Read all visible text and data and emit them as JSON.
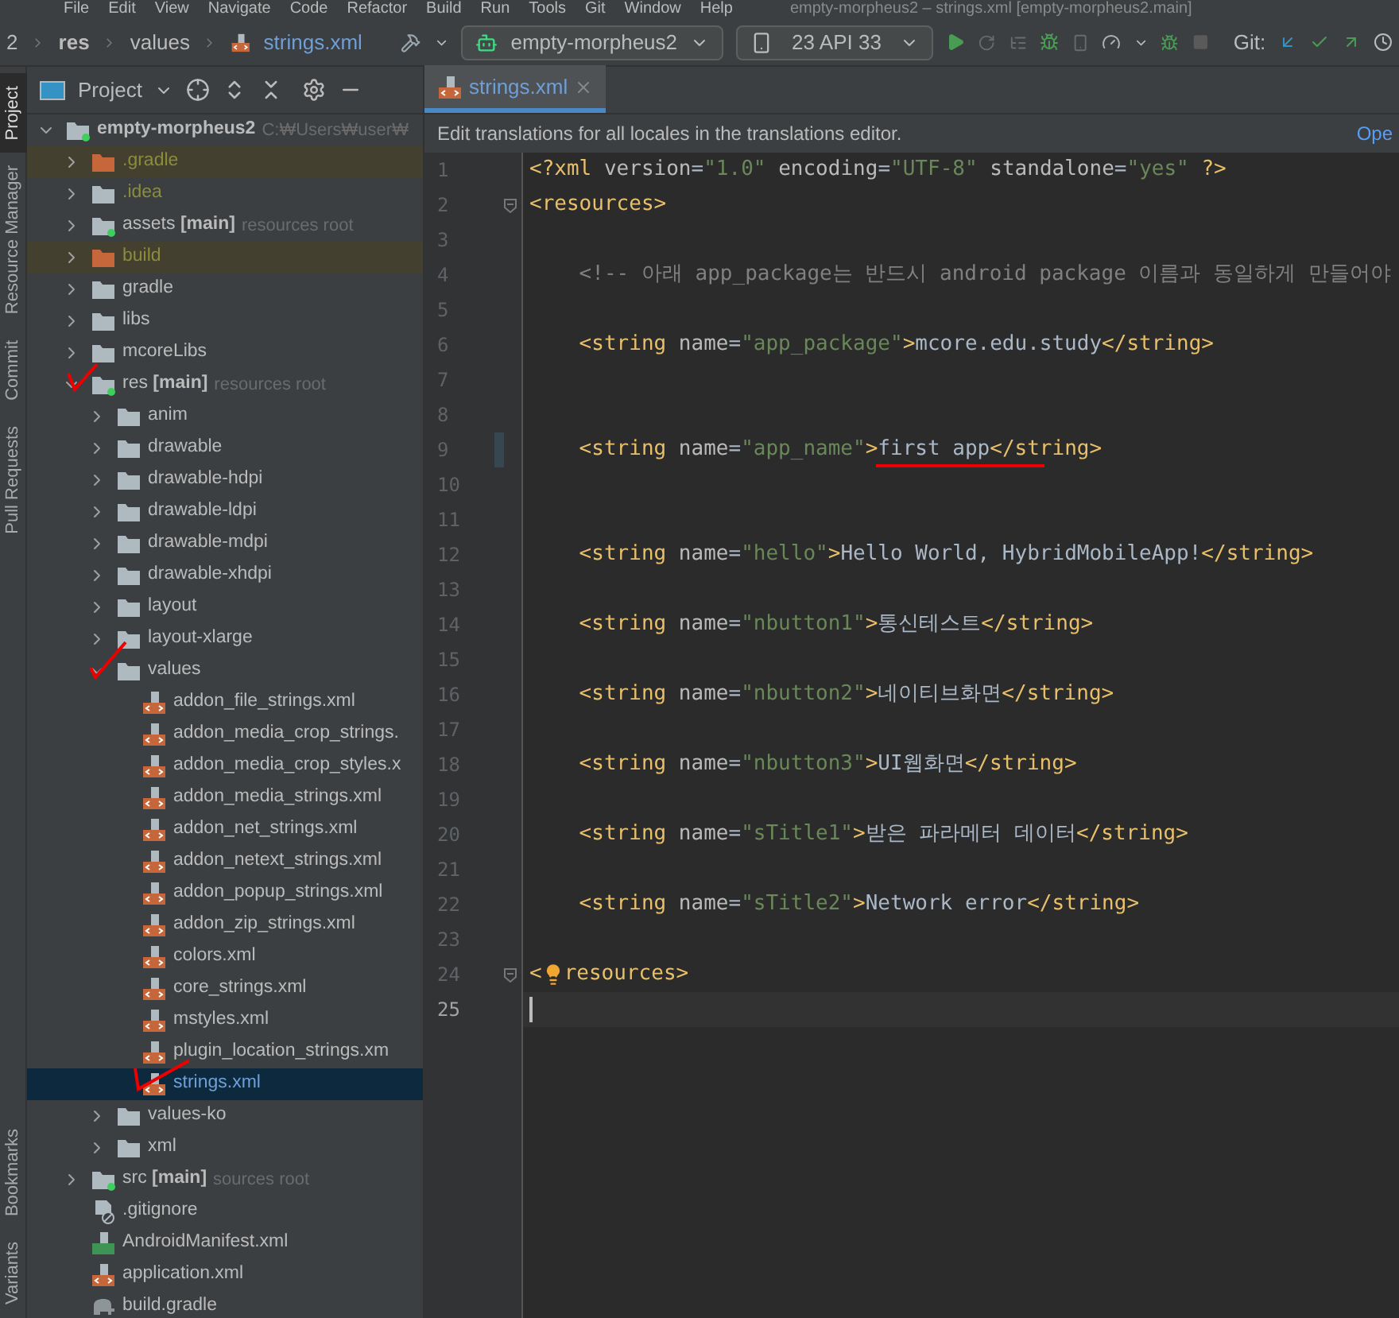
{
  "menu": {
    "items": [
      "File",
      "Edit",
      "View",
      "Navigate",
      "Code",
      "Refactor",
      "Build",
      "Run",
      "Tools",
      "Git",
      "Window",
      "Help"
    ],
    "title": "empty-morpheus2 – strings.xml [empty-morpheus2.main]"
  },
  "navbar": {
    "breadcrumbs": [
      "2",
      "res",
      "values",
      "strings.xml"
    ],
    "run_config": "empty-morpheus2",
    "device": "23",
    "api": "API 33",
    "git_label": "Git:"
  },
  "tool_strip": [
    {
      "label": "Project",
      "selected": true
    },
    {
      "label": "Resource Manager",
      "selected": false
    },
    {
      "label": "Commit",
      "selected": false
    },
    {
      "label": "Pull Requests",
      "selected": false
    },
    {
      "label": "Bookmarks",
      "selected": false
    },
    {
      "label": "Variants",
      "selected": false
    }
  ],
  "project_panel": {
    "title": "Project",
    "tree": [
      {
        "name": "empty-morpheus2",
        "kind": "module",
        "hint": "C:₩Users₩user₩",
        "selected": false,
        "expanded": true,
        "ignored": false,
        "children": [
          {
            "name": ".gradle",
            "kind": "excluded-folder",
            "selected": false,
            "expanded": false,
            "ignored": true
          },
          {
            "name": ".idea",
            "kind": "folder",
            "selected": false,
            "expanded": false,
            "ignored": true
          },
          {
            "name": "assets **[main]**",
            "kind": "source-folder",
            "hint": "resources root",
            "selected": false,
            "expanded": false,
            "ignored": false
          },
          {
            "name": "build",
            "kind": "excluded-folder",
            "selected": false,
            "expanded": false,
            "ignored": true
          },
          {
            "name": "gradle",
            "kind": "folder",
            "selected": false,
            "expanded": false,
            "ignored": false
          },
          {
            "name": "libs",
            "kind": "folder",
            "selected": false,
            "expanded": false,
            "ignored": false
          },
          {
            "name": "mcoreLibs",
            "kind": "folder",
            "selected": false,
            "expanded": false,
            "ignored": false
          },
          {
            "name": "res **[main]**",
            "kind": "source-folder",
            "hint": "resources root",
            "selected": false,
            "expanded": true,
            "ignored": false,
            "children": [
              {
                "name": "anim",
                "kind": "folder",
                "selected": false,
                "expanded": false,
                "ignored": false
              },
              {
                "name": "drawable",
                "kind": "folder",
                "selected": false,
                "expanded": false,
                "ignored": false
              },
              {
                "name": "drawable-hdpi",
                "kind": "folder",
                "selected": false,
                "expanded": false,
                "ignored": false
              },
              {
                "name": "drawable-ldpi",
                "kind": "folder",
                "selected": false,
                "expanded": false,
                "ignored": false
              },
              {
                "name": "drawable-mdpi",
                "kind": "folder",
                "selected": false,
                "expanded": false,
                "ignored": false
              },
              {
                "name": "drawable-xhdpi",
                "kind": "folder",
                "selected": false,
                "expanded": false,
                "ignored": false
              },
              {
                "name": "layout",
                "kind": "folder",
                "selected": false,
                "expanded": false,
                "ignored": false
              },
              {
                "name": "layout-xlarge",
                "kind": "folder",
                "selected": false,
                "expanded": false,
                "ignored": false
              },
              {
                "name": "values",
                "kind": "folder",
                "selected": false,
                "expanded": true,
                "ignored": false,
                "children": [
                  {
                    "name": "addon_file_strings.xml",
                    "kind": "xml",
                    "selected": false,
                    "ignored": false
                  },
                  {
                    "name": "addon_media_crop_strings.",
                    "kind": "xml",
                    "selected": false,
                    "ignored": false
                  },
                  {
                    "name": "addon_media_crop_styles.x",
                    "kind": "xml",
                    "selected": false,
                    "ignored": false
                  },
                  {
                    "name": "addon_media_strings.xml",
                    "kind": "xml",
                    "selected": false,
                    "ignored": false
                  },
                  {
                    "name": "addon_net_strings.xml",
                    "kind": "xml",
                    "selected": false,
                    "ignored": false
                  },
                  {
                    "name": "addon_netext_strings.xml",
                    "kind": "xml",
                    "selected": false,
                    "ignored": false
                  },
                  {
                    "name": "addon_popup_strings.xml",
                    "kind": "xml",
                    "selected": false,
                    "ignored": false
                  },
                  {
                    "name": "addon_zip_strings.xml",
                    "kind": "xml",
                    "selected": false,
                    "ignored": false
                  },
                  {
                    "name": "colors.xml",
                    "kind": "xml",
                    "selected": false,
                    "ignored": false
                  },
                  {
                    "name": "core_strings.xml",
                    "kind": "xml",
                    "selected": false,
                    "ignored": false
                  },
                  {
                    "name": "mstyles.xml",
                    "kind": "xml",
                    "selected": false,
                    "ignored": false
                  },
                  {
                    "name": "plugin_location_strings.xm",
                    "kind": "xml",
                    "selected": false,
                    "ignored": false
                  },
                  {
                    "name": "strings.xml",
                    "kind": "xml",
                    "selected": true,
                    "ignored": false
                  }
                ]
              },
              {
                "name": "values-ko",
                "kind": "folder",
                "selected": false,
                "expanded": false,
                "ignored": false
              },
              {
                "name": "xml",
                "kind": "folder",
                "selected": false,
                "expanded": false,
                "ignored": false
              }
            ]
          },
          {
            "name": "src **[main]**",
            "kind": "source-folder",
            "hint": "sources root",
            "selected": false,
            "expanded": false,
            "ignored": false
          },
          {
            "name": ".gitignore",
            "kind": "gitignore",
            "selected": false,
            "ignored": false
          },
          {
            "name": "AndroidManifest.xml",
            "kind": "manifest",
            "selected": false,
            "ignored": false
          },
          {
            "name": "application.xml",
            "kind": "xml",
            "selected": false,
            "ignored": false
          },
          {
            "name": "build.gradle",
            "kind": "gradle",
            "selected": false,
            "ignored": false
          }
        ]
      }
    ]
  },
  "editor": {
    "tabs": [
      {
        "label": "strings.xml",
        "selected": true
      }
    ],
    "banner": {
      "text": "Edit translations for all locales in the translations editor.",
      "link": "Ope"
    },
    "lines": [
      {
        "number": "1",
        "current": false,
        "changed": false,
        "fold": false,
        "tokens": [
          {
            "kind": "tag",
            "text": "<?xml "
          },
          {
            "kind": "attr",
            "text": "version"
          },
          {
            "kind": "plain",
            "text": "="
          },
          {
            "kind": "value",
            "text": "\"1.0\" "
          },
          {
            "kind": "attr",
            "text": "encoding"
          },
          {
            "kind": "plain",
            "text": "="
          },
          {
            "kind": "value",
            "text": "\"UTF-8\" "
          },
          {
            "kind": "attr",
            "text": "standalone"
          },
          {
            "kind": "plain",
            "text": "="
          },
          {
            "kind": "value",
            "text": "\"yes\" "
          },
          {
            "kind": "tag",
            "text": "?>"
          }
        ]
      },
      {
        "number": "2",
        "current": false,
        "changed": false,
        "fold": true,
        "tokens": [
          {
            "kind": "tag",
            "text": "<resources>"
          }
        ]
      },
      {
        "number": "3",
        "current": false,
        "changed": false,
        "fold": false
      },
      {
        "number": "4",
        "current": false,
        "changed": false,
        "fold": false,
        "tokens": [
          {
            "kind": "comment",
            "text": "    <!-- 아래 app_package는 반드시 android package 이름과 동일하게 만들어야"
          }
        ]
      },
      {
        "number": "5",
        "current": false,
        "changed": false,
        "fold": false
      },
      {
        "number": "6",
        "current": false,
        "changed": false,
        "fold": false,
        "tokens": [
          {
            "kind": "tag",
            "text": "    <string "
          },
          {
            "kind": "attr",
            "text": "name"
          },
          {
            "kind": "plain",
            "text": "="
          },
          {
            "kind": "value",
            "text": "\"app_package\""
          },
          {
            "kind": "tag",
            "text": ">"
          },
          {
            "kind": "text",
            "text": "mcore.edu.study"
          },
          {
            "kind": "tag",
            "text": "</string>"
          }
        ]
      },
      {
        "number": "7",
        "current": false,
        "changed": false,
        "fold": false
      },
      {
        "number": "8",
        "current": false,
        "changed": false,
        "fold": false
      },
      {
        "number": "9",
        "current": false,
        "changed": true,
        "fold": false,
        "tokens": [
          {
            "kind": "tag",
            "text": "    <string "
          },
          {
            "kind": "attr",
            "text": "name"
          },
          {
            "kind": "plain",
            "text": "="
          },
          {
            "kind": "value",
            "text": "\"app_name\""
          },
          {
            "kind": "tag",
            "text": ">"
          },
          {
            "kind": "text",
            "text": "first app"
          },
          {
            "kind": "tag",
            "text": "</string>"
          }
        ]
      },
      {
        "number": "10",
        "current": false,
        "changed": false,
        "fold": false
      },
      {
        "number": "11",
        "current": false,
        "changed": false,
        "fold": false
      },
      {
        "number": "12",
        "current": false,
        "changed": false,
        "fold": false,
        "tokens": [
          {
            "kind": "tag",
            "text": "    <string "
          },
          {
            "kind": "attr",
            "text": "name"
          },
          {
            "kind": "plain",
            "text": "="
          },
          {
            "kind": "value",
            "text": "\"hello\""
          },
          {
            "kind": "tag",
            "text": ">"
          },
          {
            "kind": "text",
            "text": "Hello World, HybridMobileApp!"
          },
          {
            "kind": "tag",
            "text": "</string>"
          }
        ]
      },
      {
        "number": "13",
        "current": false,
        "changed": false,
        "fold": false
      },
      {
        "number": "14",
        "current": false,
        "changed": false,
        "fold": false,
        "tokens": [
          {
            "kind": "tag",
            "text": "    <string "
          },
          {
            "kind": "attr",
            "text": "name"
          },
          {
            "kind": "plain",
            "text": "="
          },
          {
            "kind": "value",
            "text": "\"nbutton1\""
          },
          {
            "kind": "tag",
            "text": ">"
          },
          {
            "kind": "text",
            "text": "통신테스트"
          },
          {
            "kind": "tag",
            "text": "</string>"
          }
        ]
      },
      {
        "number": "15",
        "current": false,
        "changed": false,
        "fold": false
      },
      {
        "number": "16",
        "current": false,
        "changed": false,
        "fold": false,
        "tokens": [
          {
            "kind": "tag",
            "text": "    <string "
          },
          {
            "kind": "attr",
            "text": "name"
          },
          {
            "kind": "plain",
            "text": "="
          },
          {
            "kind": "value",
            "text": "\"nbutton2\""
          },
          {
            "kind": "tag",
            "text": ">"
          },
          {
            "kind": "text",
            "text": "네이티브화면"
          },
          {
            "kind": "tag",
            "text": "</string>"
          }
        ]
      },
      {
        "number": "17",
        "current": false,
        "changed": false,
        "fold": false
      },
      {
        "number": "18",
        "current": false,
        "changed": false,
        "fold": false,
        "tokens": [
          {
            "kind": "tag",
            "text": "    <string "
          },
          {
            "kind": "attr",
            "text": "name"
          },
          {
            "kind": "plain",
            "text": "="
          },
          {
            "kind": "value",
            "text": "\"nbutton3\""
          },
          {
            "kind": "tag",
            "text": ">"
          },
          {
            "kind": "text",
            "text": "UI웹화면"
          },
          {
            "kind": "tag",
            "text": "</string>"
          }
        ]
      },
      {
        "number": "19",
        "current": false,
        "changed": false,
        "fold": false
      },
      {
        "number": "20",
        "current": false,
        "changed": false,
        "fold": false,
        "tokens": [
          {
            "kind": "tag",
            "text": "    <string "
          },
          {
            "kind": "attr",
            "text": "name"
          },
          {
            "kind": "plain",
            "text": "="
          },
          {
            "kind": "value",
            "text": "\"sTitle1\""
          },
          {
            "kind": "tag",
            "text": ">"
          },
          {
            "kind": "text",
            "text": "받은 파라메터 데이터"
          },
          {
            "kind": "tag",
            "text": "</string>"
          }
        ]
      },
      {
        "number": "21",
        "current": false,
        "changed": false,
        "fold": false
      },
      {
        "number": "22",
        "current": false,
        "changed": false,
        "fold": false,
        "tokens": [
          {
            "kind": "tag",
            "text": "    <string "
          },
          {
            "kind": "attr",
            "text": "name"
          },
          {
            "kind": "plain",
            "text": "="
          },
          {
            "kind": "value",
            "text": "\"sTitle2\""
          },
          {
            "kind": "tag",
            "text": ">"
          },
          {
            "kind": "text",
            "text": "Network error"
          },
          {
            "kind": "tag",
            "text": "</string>"
          }
        ]
      },
      {
        "number": "23",
        "current": false,
        "changed": false,
        "fold": false
      },
      {
        "number": "24",
        "current": false,
        "changed": false,
        "fold": true,
        "tokens": [
          {
            "kind": "tag",
            "text": "<"
          },
          {
            "kind": "bulb"
          },
          {
            "kind": "tag",
            "text": "resources>"
          }
        ]
      },
      {
        "number": "25",
        "current": true,
        "changed": false,
        "fold": false
      }
    ]
  }
}
